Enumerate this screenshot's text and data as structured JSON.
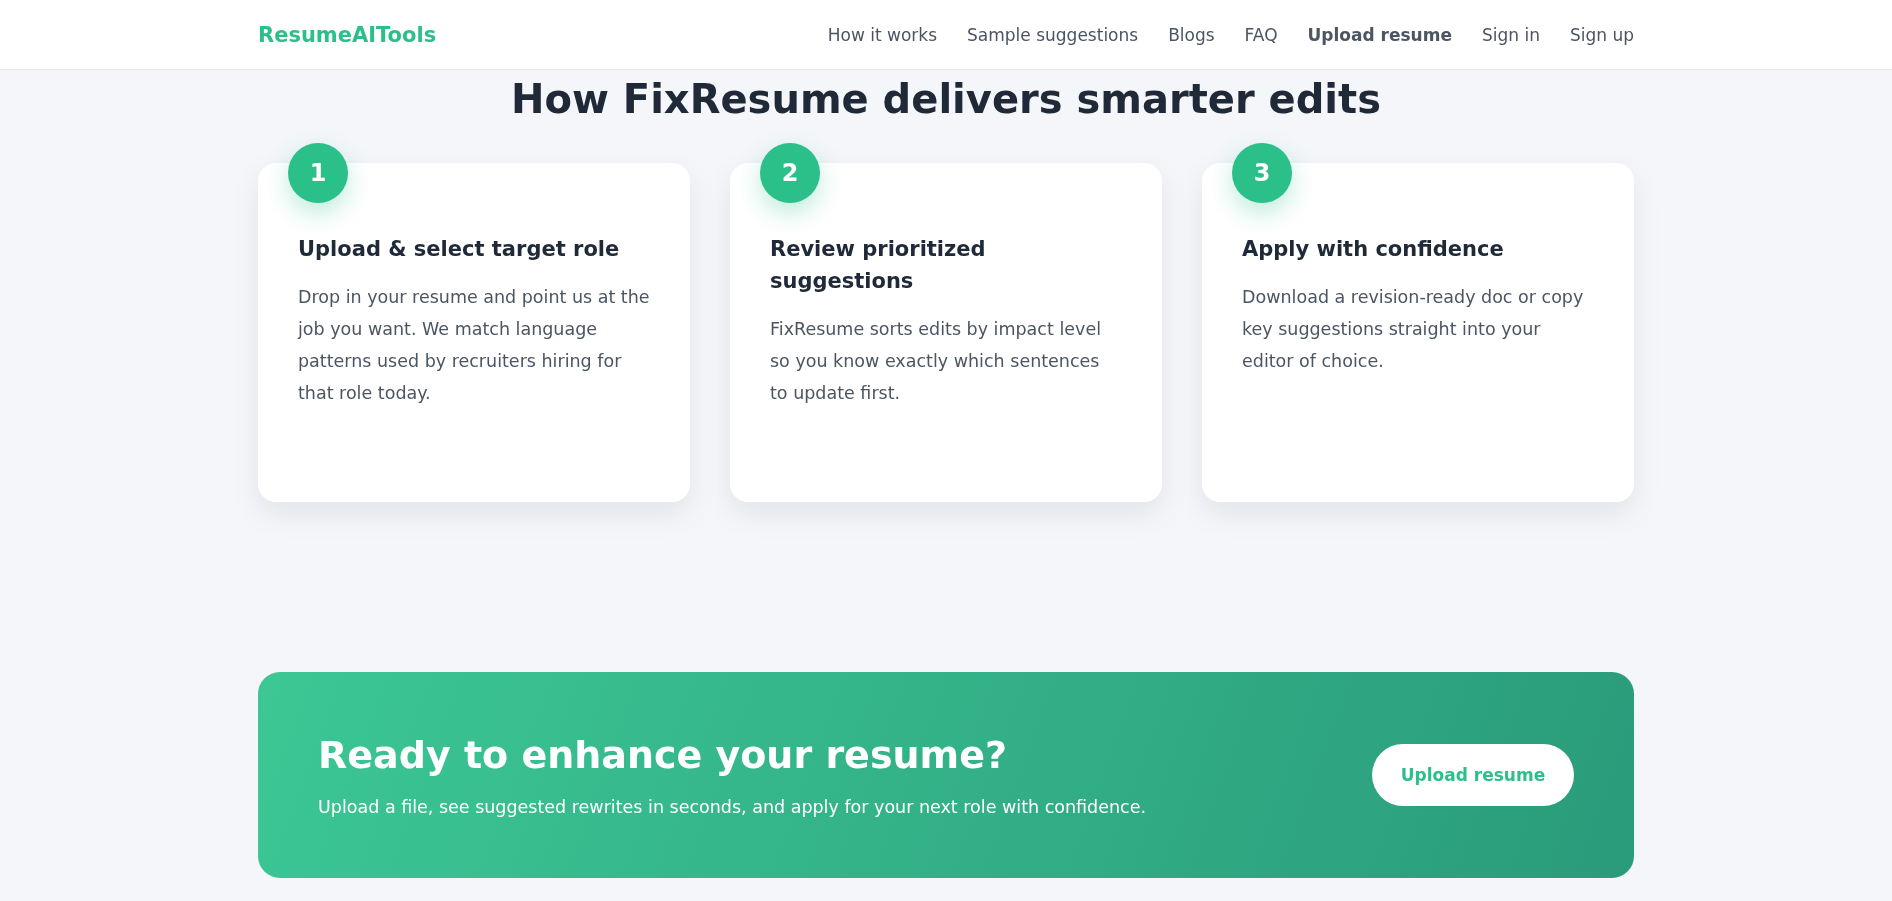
{
  "header": {
    "logo": "ResumeAITools",
    "nav": [
      {
        "label": "How it works",
        "highlighted": false
      },
      {
        "label": "Sample suggestions",
        "highlighted": false
      },
      {
        "label": "Blogs",
        "highlighted": false
      },
      {
        "label": "FAQ",
        "highlighted": false
      },
      {
        "label": "Upload resume",
        "highlighted": true
      },
      {
        "label": "Sign in",
        "highlighted": false
      },
      {
        "label": "Sign up",
        "highlighted": false
      }
    ]
  },
  "section": {
    "title": "How FixResume delivers smarter edits",
    "steps": [
      {
        "number": "1",
        "title": "Upload & select target role",
        "text": "Drop in your resume and point us at the job you want. We match language patterns used by recruiters hiring for that role today."
      },
      {
        "number": "2",
        "title": "Review prioritized suggestions",
        "text": "FixResume sorts edits by impact level so you know exactly which sentences to update first."
      },
      {
        "number": "3",
        "title": "Apply with confidence",
        "text": "Download a revision-ready doc or copy key suggestions straight into your editor of choice."
      }
    ]
  },
  "cta": {
    "title": "Ready to enhance your resume?",
    "text": "Upload a file, see suggested rewrites in seconds, and apply for your next role with confidence.",
    "button": "Upload resume"
  }
}
